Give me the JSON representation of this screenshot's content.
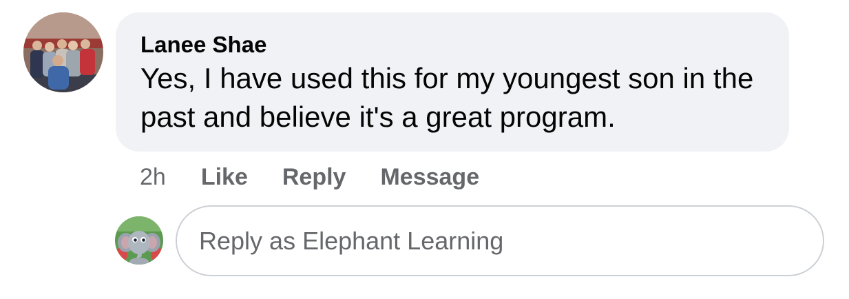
{
  "comment": {
    "author": "Lanee Shae",
    "text": "Yes, I have used this for my youngest son in the past and believe it's a great program.",
    "timestamp": "2h",
    "actions": {
      "like": "Like",
      "reply": "Reply",
      "message": "Message"
    },
    "avatar_icon": "profile-photo-group"
  },
  "reply_composer": {
    "placeholder": "Reply as Elephant Learning",
    "avatar_icon": "elephant-mascot"
  },
  "colors": {
    "bubble_background": "#f0f2f5",
    "primary_text": "#050505",
    "secondary_text": "#65676b",
    "input_border": "#ccd0d5"
  }
}
